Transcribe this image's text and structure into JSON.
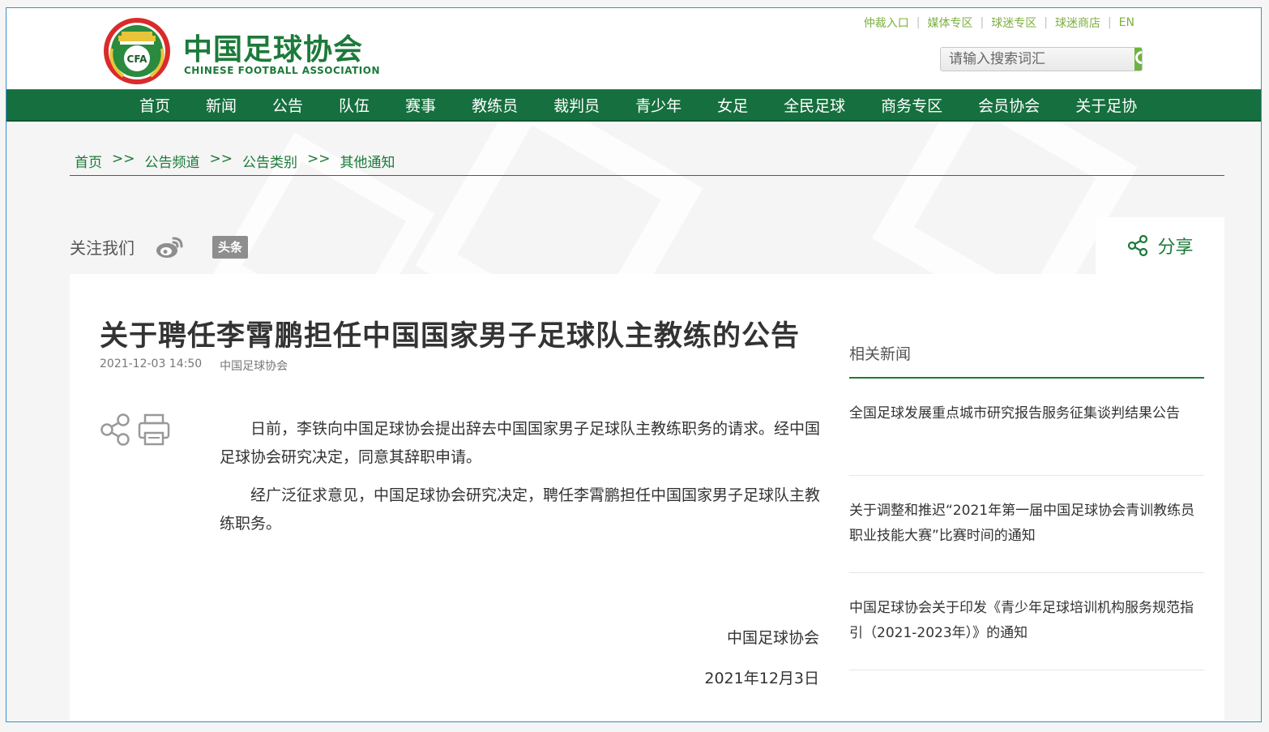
{
  "header": {
    "logo_cn": "中国足球协会",
    "logo_en": "CHINESE FOOTBALL ASSOCIATION",
    "emblem_text": "CFA",
    "top_links": [
      "仲裁入口",
      "媒体专区",
      "球迷专区",
      "球迷商店",
      "EN"
    ],
    "search_placeholder": "请输入搜索词汇"
  },
  "nav": {
    "items": [
      "首页",
      "新闻",
      "公告",
      "队伍",
      "赛事",
      "教练员",
      "裁判员",
      "青少年",
      "女足",
      "全民足球",
      "商务专区",
      "会员协会",
      "关于足协"
    ]
  },
  "breadcrumb": {
    "items": [
      "首页",
      "公告频道",
      "公告类别",
      "其他通知"
    ],
    "separator": ">>"
  },
  "follow": {
    "label": "关注我们",
    "toutiao": "头条",
    "share_label": "分享"
  },
  "article": {
    "title": "关于聘任李霄鹏担任中国国家男子足球队主教练的公告",
    "datetime": "2021-12-03 14:50",
    "source": "中国足球协会",
    "paragraphs": [
      "日前，李铁向中国足球协会提出辞去中国国家男子足球队主教练职务的请求。经中国足球协会研究决定，同意其辞职申请。",
      "经广泛征求意见，中国足球协会研究决定，聘任李霄鹏担任中国国家男子足球队主教练职务。"
    ],
    "signature": "中国足球协会",
    "signature_date": "2021年12月3日"
  },
  "related": {
    "title": "相关新闻",
    "items": [
      "全国足球发展重点城市研究报告服务征集谈判结果公告",
      "关于调整和推迟“2021年第一届中国足球协会青训教练员职业技能大赛”比赛时间的通知",
      "中国足球协会关于印发《青少年足球培训机构服务规范指引（2021-2023年）》的通知"
    ]
  },
  "colors": {
    "brand_green": "#1c7a3a",
    "nav_green": "#166f3e",
    "link_lightgreen": "#7bb03e",
    "search_btn": "#6db33f"
  }
}
